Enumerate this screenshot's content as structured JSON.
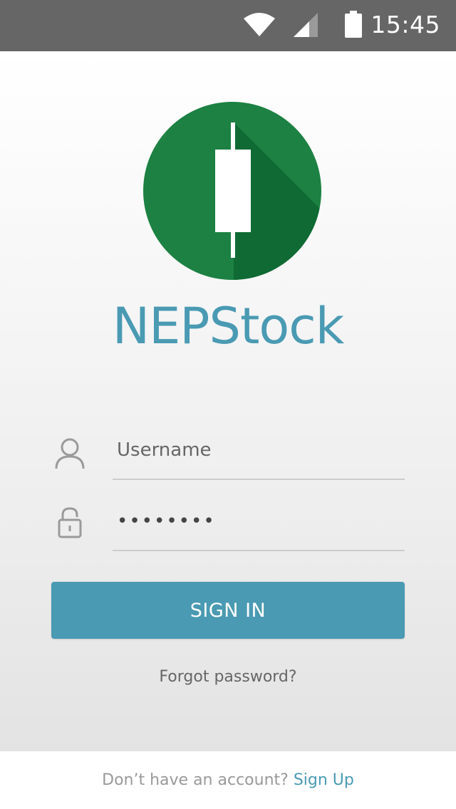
{
  "status_bar": {
    "time": "15:45",
    "icons": [
      "wifi-icon",
      "signal-icon",
      "battery-icon"
    ]
  },
  "app": {
    "name": "NEPStock",
    "logo_icon": "candlestick-logo-icon",
    "colors": {
      "logo_green": "#1c8142",
      "logo_shadow": "#0f6a34",
      "accent": "#4a9ab3"
    }
  },
  "form": {
    "username_placeholder": "Username",
    "username_icon": "user-icon",
    "password_value": "••••••••",
    "password_icon": "lock-icon",
    "sign_in_label": "SIGN IN",
    "forgot_password": "Forgot password?"
  },
  "footer": {
    "prompt": "Don’t have an account?",
    "sign_up_label": "Sign Up"
  }
}
